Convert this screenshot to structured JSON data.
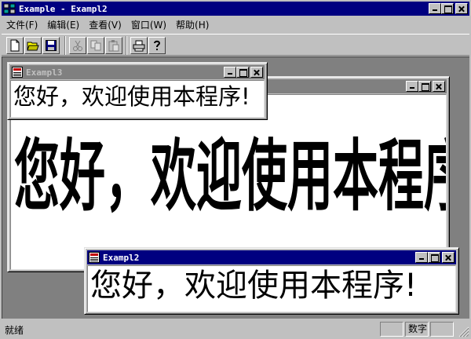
{
  "window": {
    "title": "Example - Exampl2"
  },
  "menu": {
    "items": [
      {
        "label": "文件(F)"
      },
      {
        "label": "编辑(E)"
      },
      {
        "label": "查看(V)"
      },
      {
        "label": "窗口(W)"
      },
      {
        "label": "帮助(H)"
      }
    ]
  },
  "toolbar": {
    "buttons": [
      "new-file-icon",
      "open-folder-icon",
      "save-disk-icon",
      "cut-icon",
      "copy-icon",
      "paste-icon",
      "print-icon",
      "help-icon"
    ]
  },
  "children": [
    {
      "title": "Exampl3",
      "text": "您好，欢迎使用本程序!",
      "state": "inactive"
    },
    {
      "title": "",
      "text": "您好，欢迎使用本程序!",
      "state": "inactive"
    },
    {
      "title": "Exampl2",
      "text": "您好，欢迎使用本程序!",
      "state": "active"
    }
  ],
  "status": {
    "text": "就绪",
    "panes": [
      "",
      "数字",
      ""
    ]
  },
  "colors": {
    "active_title": "#000080",
    "inactive_title": "#808080",
    "face": "#c0c0c0",
    "mdi_background": "#808080"
  }
}
